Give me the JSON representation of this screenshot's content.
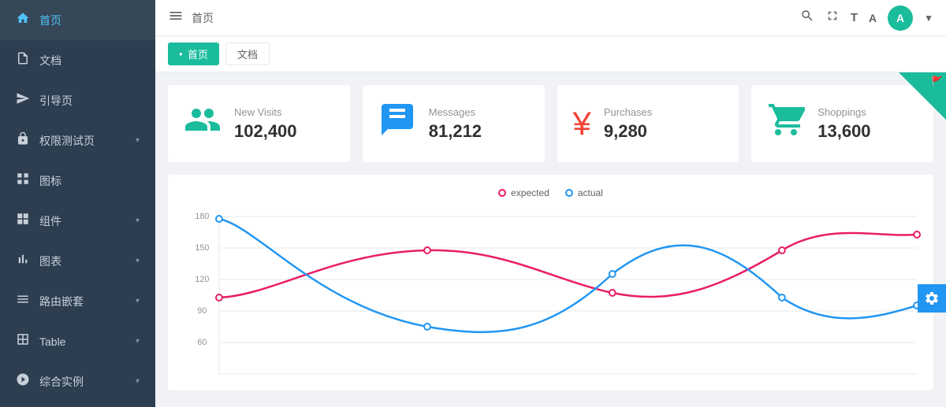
{
  "sidebar": {
    "items": [
      {
        "id": "home",
        "label": "首页",
        "icon": "🏠",
        "active": true,
        "hasChevron": false
      },
      {
        "id": "docs",
        "label": "文档",
        "icon": "📄",
        "active": false,
        "hasChevron": false
      },
      {
        "id": "guide",
        "label": "引导页",
        "icon": "➤",
        "active": false,
        "hasChevron": false
      },
      {
        "id": "permission",
        "label": "权限测试页",
        "icon": "🔒",
        "active": false,
        "hasChevron": true
      },
      {
        "id": "icon",
        "label": "图标",
        "icon": "🔲",
        "active": false,
        "hasChevron": false
      },
      {
        "id": "components",
        "label": "组件",
        "icon": "⊞",
        "active": false,
        "hasChevron": true
      },
      {
        "id": "charts",
        "label": "图表",
        "icon": "📊",
        "active": false,
        "hasChevron": true
      },
      {
        "id": "router",
        "label": "路由嵌套",
        "icon": "☰",
        "active": false,
        "hasChevron": true
      },
      {
        "id": "table",
        "label": "Table",
        "icon": "⊟",
        "active": false,
        "hasChevron": true
      },
      {
        "id": "examples",
        "label": "综合实例",
        "icon": "⚙",
        "active": false,
        "hasChevron": true
      }
    ]
  },
  "header": {
    "menu_icon": "≡",
    "title": "首页",
    "search_icon": "🔍",
    "fullscreen_icon": "⛶",
    "text_size_icon": "T",
    "lang_icon": "A",
    "avatar_text": "A",
    "dropdown_icon": "▼"
  },
  "breadcrumb": {
    "tabs": [
      {
        "id": "home",
        "label": "首页",
        "active": true
      },
      {
        "id": "docs",
        "label": "文档",
        "active": false
      }
    ]
  },
  "stats": [
    {
      "id": "new-visits",
      "label": "New Visits",
      "value": "102,400",
      "icon": "👥",
      "icon_class": "teal"
    },
    {
      "id": "messages",
      "label": "Messages",
      "value": "81,212",
      "icon": "💬",
      "icon_class": "blue"
    },
    {
      "id": "purchases",
      "label": "Purchases",
      "value": "9,280",
      "icon": "¥",
      "icon_class": "red"
    },
    {
      "id": "shoppings",
      "label": "Shoppings",
      "value": "13,600",
      "icon": "🛒",
      "icon_class": "green"
    }
  ],
  "chart": {
    "legend": {
      "expected_label": "expected",
      "actual_label": "actual"
    },
    "y_axis": [
      "180",
      "150",
      "120",
      "90",
      "60"
    ],
    "accent_color": "#1abc9c",
    "expected_color": "#e91e63",
    "actual_color": "#2196f3"
  },
  "settings_icon": "⚙"
}
